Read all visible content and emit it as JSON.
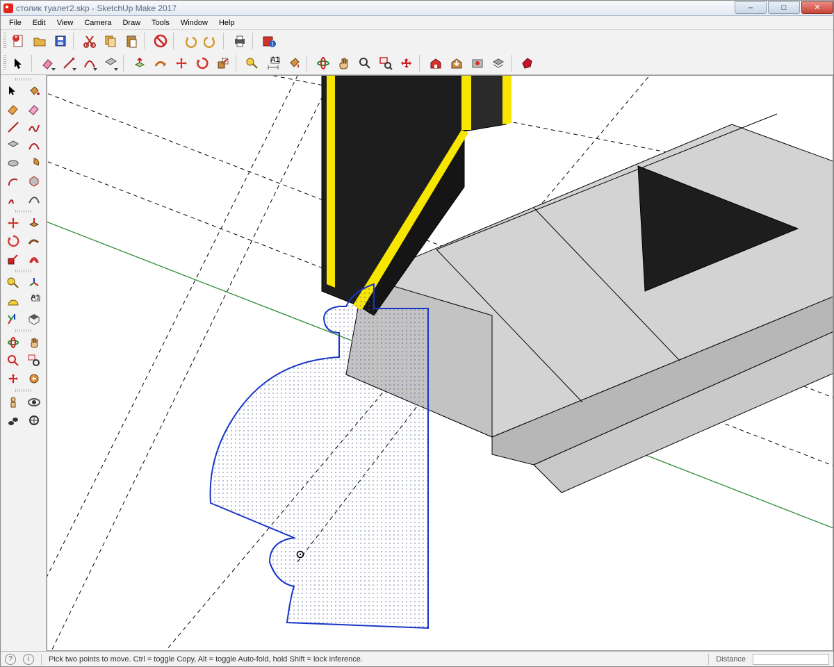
{
  "title": "столик туалет2.skp - SketchUp Make 2017",
  "window_buttons": {
    "min": "–",
    "max": "□",
    "close": "✕"
  },
  "menu": [
    "File",
    "Edit",
    "View",
    "Camera",
    "Draw",
    "Tools",
    "Window",
    "Help"
  ],
  "top_toolbar1": [
    "new-file",
    "open-file",
    "save-file",
    "|",
    "cut",
    "copy",
    "paste",
    "|",
    "erase-large",
    "|",
    "undo",
    "redo",
    "|",
    "print",
    "|",
    "model-info"
  ],
  "top_toolbar2": [
    "select-arrow",
    "|",
    "eraser",
    "pencil",
    "arc",
    "rectangle",
    "|",
    "push-pull",
    "follow-me",
    "move",
    "rotate",
    "scale",
    "|",
    "tape-measure",
    "dimension",
    "paint-bucket",
    "|",
    "orbit",
    "pan",
    "zoom",
    "zoom-window",
    "zoom-extents",
    "|",
    "warehouse-get",
    "warehouse-share",
    "extension-warehouse",
    "layers-panel",
    "|",
    "ruby-console"
  ],
  "side_toolbar": [
    [
      "select-arrow",
      "paint-bucket"
    ],
    [
      "eraser-orange",
      "eraser-pink"
    ],
    [
      "pencil",
      "freehand"
    ],
    [
      "rectangle",
      "arc"
    ],
    [
      "circle",
      "pie"
    ],
    [
      "arc2",
      "polygon"
    ],
    [
      "3dtext",
      "bezier"
    ],
    [
      "move",
      "push-pull"
    ],
    [
      "rotate",
      "follow-me"
    ],
    [
      "scale",
      "offset"
    ],
    [
      "tape-measure",
      "axes"
    ],
    [
      "protractor",
      "dimension"
    ],
    [
      "text-label",
      "section-plane"
    ],
    [
      "orbit",
      "pan"
    ],
    [
      "zoom",
      "zoom-window"
    ],
    [
      "zoom-extents",
      "previous-view"
    ],
    [
      "position-camera",
      "look-around"
    ],
    [
      "walk",
      "walk-eye"
    ]
  ],
  "status": {
    "hint": "Pick two points to move.  Ctrl = toggle Copy, Alt = toggle Auto-fold, hold Shift = lock inference.",
    "vcb_label": "Distance",
    "vcb_value": ""
  },
  "colors": {
    "accent_red": "#d2322b",
    "accent_yellow": "#f7e600",
    "guide_green": "#2b8c36",
    "selection_blue": "#1836c7"
  }
}
